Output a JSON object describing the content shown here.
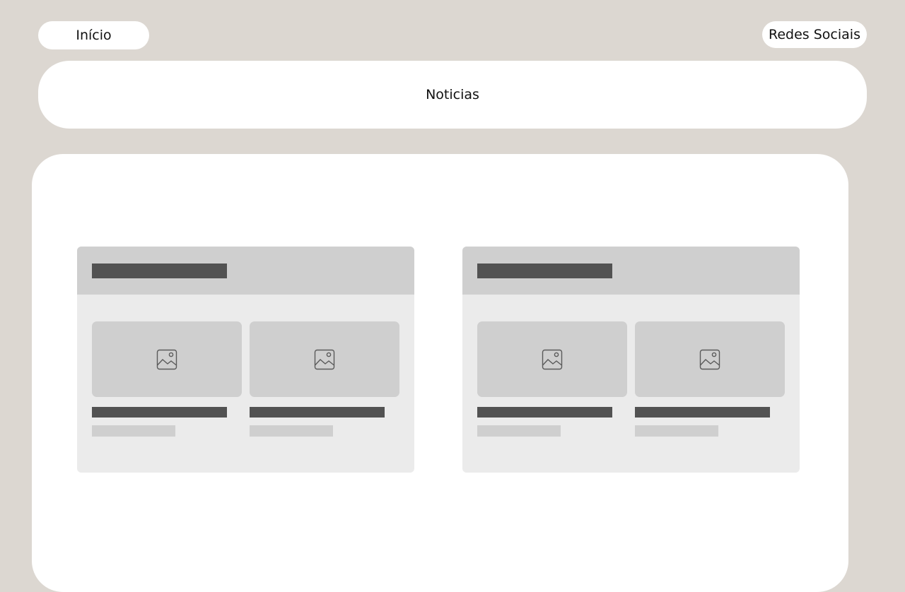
{
  "nav": {
    "home_label": "Início",
    "social_label": "Redes Sociais"
  },
  "header": {
    "title": "Noticias"
  },
  "cards": [
    {
      "items": [
        {
          "icon": "image-icon"
        },
        {
          "icon": "image-icon"
        }
      ]
    },
    {
      "items": [
        {
          "icon": "image-icon"
        },
        {
          "icon": "image-icon"
        }
      ]
    }
  ],
  "colors": {
    "background": "#dcd7d1",
    "surface": "#ffffff",
    "placeholder_dark": "#525252",
    "placeholder_light": "#cfcfcf",
    "card_body": "#ebebeb"
  }
}
